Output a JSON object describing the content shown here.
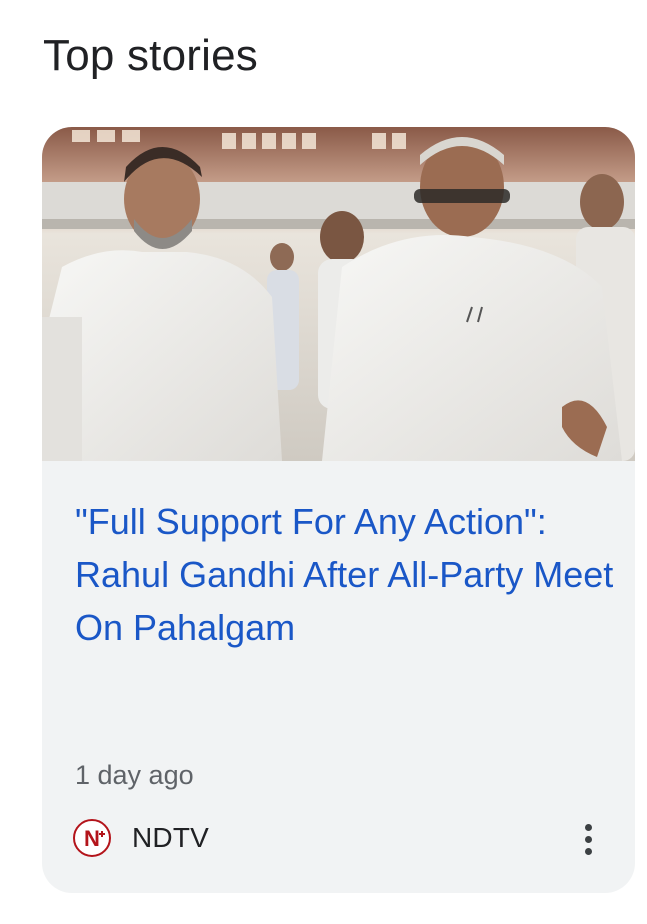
{
  "section": {
    "title": "Top stories"
  },
  "story": {
    "headline": "\"Full Support For Any Action\": Rahul Gandhi After All-Party Meet On Pahalgam",
    "timestamp": "1 day ago",
    "source": {
      "name": "NDTV",
      "logo_text": "N",
      "logo_color": "#b3141b"
    },
    "image_alt": "Photo of politicians in white attire at a meeting"
  },
  "colors": {
    "headline": "#1a57c7",
    "card_background": "#f1f3f4",
    "title": "#202124",
    "meta": "#5f6368"
  },
  "icons": {
    "more": "more-vert-icon"
  }
}
